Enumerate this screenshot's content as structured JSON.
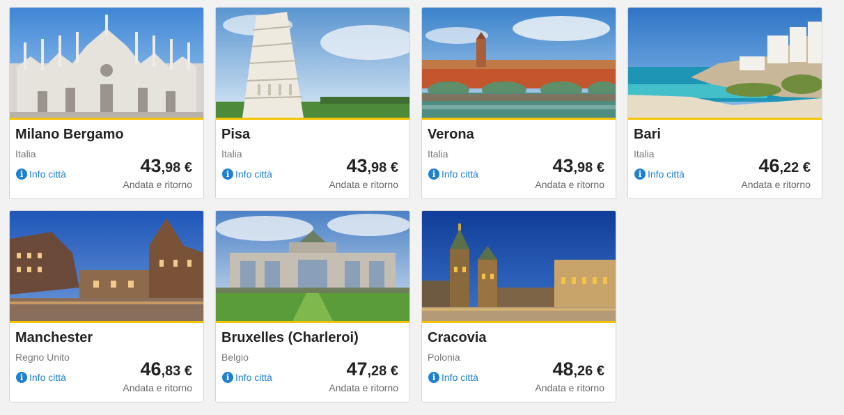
{
  "destinations": [
    {
      "city": "Milano Bergamo",
      "country": "Italia",
      "info_label": "Info città",
      "price_int": "43",
      "price_dec": ",98",
      "currency": " €",
      "trip_type": "Andata e ritorno",
      "image": "milan-cathedral-photo"
    },
    {
      "city": "Pisa",
      "country": "Italia",
      "info_label": "Info città",
      "price_int": "43",
      "price_dec": ",98",
      "currency": " €",
      "trip_type": "Andata e ritorno",
      "image": "leaning-tower-photo"
    },
    {
      "city": "Verona",
      "country": "Italia",
      "info_label": "Info città",
      "price_int": "43",
      "price_dec": ",98",
      "currency": " €",
      "trip_type": "Andata e ritorno",
      "image": "verona-bridge-photo"
    },
    {
      "city": "Bari",
      "country": "Italia",
      "info_label": "Info città",
      "price_int": "46",
      "price_dec": ",22",
      "currency": " €",
      "trip_type": "Andata e ritorno",
      "image": "bari-coast-photo"
    },
    {
      "city": "Manchester",
      "country": "Regno Unito",
      "info_label": "Info città",
      "price_int": "46",
      "price_dec": ",83",
      "currency": " €",
      "trip_type": "Andata e ritorno",
      "image": "manchester-townhall-photo"
    },
    {
      "city": "Bruxelles (Charleroi)",
      "country": "Belgio",
      "info_label": "Info città",
      "price_int": "47",
      "price_dec": ",28",
      "currency": " €",
      "trip_type": "Andata e ritorno",
      "image": "brussels-arch-photo"
    },
    {
      "city": "Cracovia",
      "country": "Polonia",
      "info_label": "Info città",
      "price_int": "48",
      "price_dec": ",26",
      "currency": " €",
      "trip_type": "Andata e ritorno",
      "image": "krakow-square-photo"
    }
  ],
  "colors": {
    "accent": "#f5c400",
    "link": "#1f7fd1",
    "text": "#222222",
    "muted": "#777777",
    "background": "#f2f2f2"
  },
  "icons": {
    "info": "info-icon"
  }
}
